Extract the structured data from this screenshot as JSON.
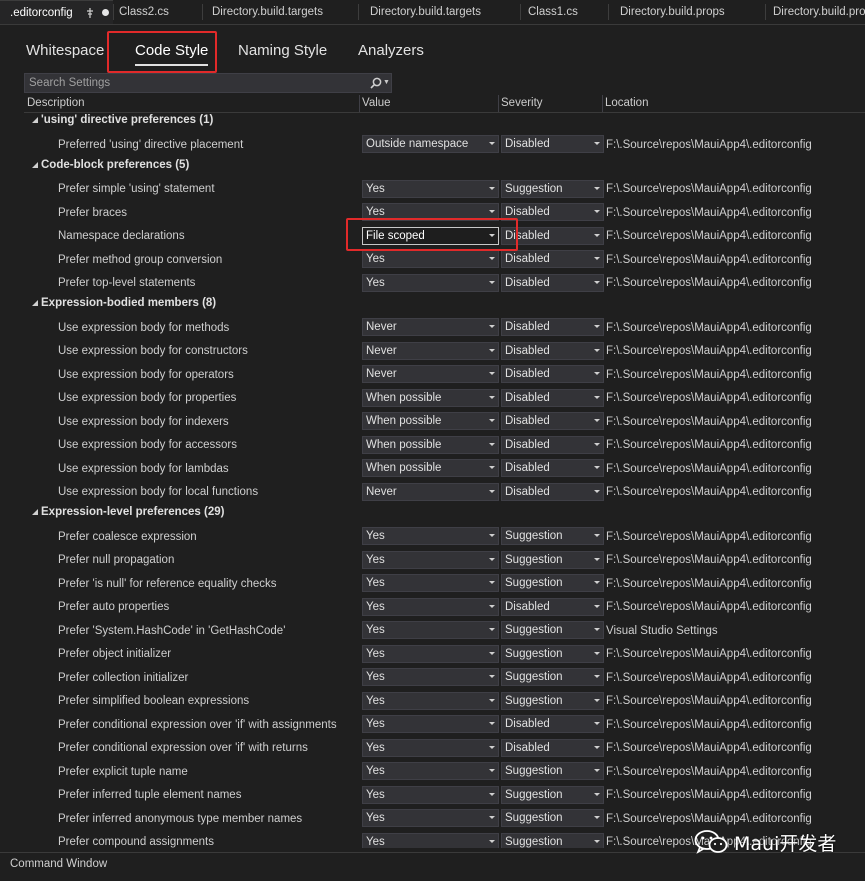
{
  "doc_tabs": [
    {
      "label": ".editorconfig",
      "active": true
    },
    {
      "label": "Class2.cs"
    },
    {
      "label": "Directory.build.targets"
    },
    {
      "label": "Directory.build.targets"
    },
    {
      "label": "Class1.cs"
    },
    {
      "label": "Directory.build.props"
    },
    {
      "label": "Directory.build.props"
    }
  ],
  "settings_tabs": [
    "Whitespace",
    "Code Style",
    "Naming Style",
    "Analyzers"
  ],
  "active_settings_tab": "Code Style",
  "search": {
    "placeholder": "Search Settings"
  },
  "columns": {
    "description": "Description",
    "value": "Value",
    "severity": "Severity",
    "location": "Location"
  },
  "groups": [
    {
      "title": "'using' directive preferences",
      "count": "(1)",
      "rows": [
        {
          "desc": "Preferred 'using' directive placement",
          "value": "Outside namespace",
          "severity": "Disabled",
          "location": "F:\\.Source\\repos\\MauiApp4\\.editorconfig"
        }
      ]
    },
    {
      "title": "Code-block preferences",
      "count": "(5)",
      "rows": [
        {
          "desc": "Prefer simple 'using' statement",
          "value": "Yes",
          "severity": "Suggestion",
          "location": "F:\\.Source\\repos\\MauiApp4\\.editorconfig"
        },
        {
          "desc": "Prefer braces",
          "value": "Yes",
          "severity": "Disabled",
          "location": "F:\\.Source\\repos\\MauiApp4\\.editorconfig"
        },
        {
          "desc": "Namespace declarations",
          "value": "File scoped",
          "severity": "Disabled",
          "location": "F:\\.Source\\repos\\MauiApp4\\.editorconfig",
          "highlight": true
        },
        {
          "desc": "Prefer method group conversion",
          "value": "Yes",
          "severity": "Disabled",
          "location": "F:\\.Source\\repos\\MauiApp4\\.editorconfig"
        },
        {
          "desc": "Prefer top-level statements",
          "value": "Yes",
          "severity": "Disabled",
          "location": "F:\\.Source\\repos\\MauiApp4\\.editorconfig"
        }
      ]
    },
    {
      "title": "Expression-bodied members",
      "count": "(8)",
      "rows": [
        {
          "desc": "Use expression body for methods",
          "value": "Never",
          "severity": "Disabled",
          "location": "F:\\.Source\\repos\\MauiApp4\\.editorconfig"
        },
        {
          "desc": "Use expression body for constructors",
          "value": "Never",
          "severity": "Disabled",
          "location": "F:\\.Source\\repos\\MauiApp4\\.editorconfig"
        },
        {
          "desc": "Use expression body for operators",
          "value": "Never",
          "severity": "Disabled",
          "location": "F:\\.Source\\repos\\MauiApp4\\.editorconfig"
        },
        {
          "desc": "Use expression body for properties",
          "value": "When possible",
          "severity": "Disabled",
          "location": "F:\\.Source\\repos\\MauiApp4\\.editorconfig"
        },
        {
          "desc": "Use expression body for indexers",
          "value": "When possible",
          "severity": "Disabled",
          "location": "F:\\.Source\\repos\\MauiApp4\\.editorconfig"
        },
        {
          "desc": "Use expression body for accessors",
          "value": "When possible",
          "severity": "Disabled",
          "location": "F:\\.Source\\repos\\MauiApp4\\.editorconfig"
        },
        {
          "desc": "Use expression body for lambdas",
          "value": "When possible",
          "severity": "Disabled",
          "location": "F:\\.Source\\repos\\MauiApp4\\.editorconfig"
        },
        {
          "desc": "Use expression body for local functions",
          "value": "Never",
          "severity": "Disabled",
          "location": "F:\\.Source\\repos\\MauiApp4\\.editorconfig"
        }
      ]
    },
    {
      "title": "Expression-level preferences",
      "count": "(29)",
      "rows": [
        {
          "desc": "Prefer coalesce expression",
          "value": "Yes",
          "severity": "Suggestion",
          "location": "F:\\.Source\\repos\\MauiApp4\\.editorconfig"
        },
        {
          "desc": "Prefer null propagation",
          "value": "Yes",
          "severity": "Suggestion",
          "location": "F:\\.Source\\repos\\MauiApp4\\.editorconfig"
        },
        {
          "desc": "Prefer 'is null' for reference equality checks",
          "value": "Yes",
          "severity": "Suggestion",
          "location": "F:\\.Source\\repos\\MauiApp4\\.editorconfig"
        },
        {
          "desc": "Prefer auto properties",
          "value": "Yes",
          "severity": "Disabled",
          "location": "F:\\.Source\\repos\\MauiApp4\\.editorconfig"
        },
        {
          "desc": "Prefer 'System.HashCode' in 'GetHashCode'",
          "value": "Yes",
          "severity": "Suggestion",
          "location": "Visual Studio Settings"
        },
        {
          "desc": "Prefer object initializer",
          "value": "Yes",
          "severity": "Suggestion",
          "location": "F:\\.Source\\repos\\MauiApp4\\.editorconfig"
        },
        {
          "desc": "Prefer collection initializer",
          "value": "Yes",
          "severity": "Suggestion",
          "location": "F:\\.Source\\repos\\MauiApp4\\.editorconfig"
        },
        {
          "desc": "Prefer simplified boolean expressions",
          "value": "Yes",
          "severity": "Suggestion",
          "location": "F:\\.Source\\repos\\MauiApp4\\.editorconfig"
        },
        {
          "desc": "Prefer conditional expression over 'if' with assignments",
          "value": "Yes",
          "severity": "Disabled",
          "location": "F:\\.Source\\repos\\MauiApp4\\.editorconfig"
        },
        {
          "desc": "Prefer conditional expression over 'if' with returns",
          "value": "Yes",
          "severity": "Disabled",
          "location": "F:\\.Source\\repos\\MauiApp4\\.editorconfig"
        },
        {
          "desc": "Prefer explicit tuple name",
          "value": "Yes",
          "severity": "Suggestion",
          "location": "F:\\.Source\\repos\\MauiApp4\\.editorconfig"
        },
        {
          "desc": "Prefer inferred tuple element names",
          "value": "Yes",
          "severity": "Suggestion",
          "location": "F:\\.Source\\repos\\MauiApp4\\.editorconfig"
        },
        {
          "desc": "Prefer inferred anonymous type member names",
          "value": "Yes",
          "severity": "Suggestion",
          "location": "F:\\.Source\\repos\\MauiApp4\\.editorconfig"
        },
        {
          "desc": "Prefer compound assignments",
          "value": "Yes",
          "severity": "Suggestion",
          "location": "F:\\.Source\\repos\\MauiApp4\\.editorconfig"
        }
      ]
    }
  ],
  "bottom_panel": {
    "title": "Command Window"
  },
  "watermark": {
    "text": "Maui开发者"
  },
  "colors": {
    "highlight_box": "#e12a2a",
    "background": "#1f1f1f",
    "combo_bg": "#333337"
  }
}
